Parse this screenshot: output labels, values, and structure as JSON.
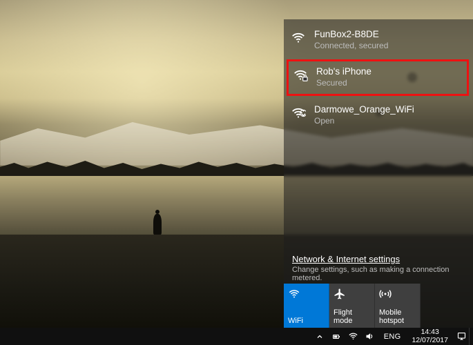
{
  "networks": [
    {
      "name": "FunBox2-B8DE",
      "status": "Connected, secured",
      "secured": true,
      "highlight": false
    },
    {
      "name": "Rob's iPhone",
      "status": "Secured",
      "secured": true,
      "highlight": true
    },
    {
      "name": "Darmowe_Orange_WiFi",
      "status": "Open",
      "secured": false,
      "highlight": false
    }
  ],
  "settings": {
    "link_label": "Network & Internet settings",
    "sub_label": "Change settings, such as making a connection metered."
  },
  "tiles": {
    "wifi": "WiFi",
    "flight": "Flight mode",
    "hotspot": "Mobile hotspot"
  },
  "taskbar": {
    "lang": "ENG",
    "time": "14:43",
    "date": "12/07/2017"
  }
}
